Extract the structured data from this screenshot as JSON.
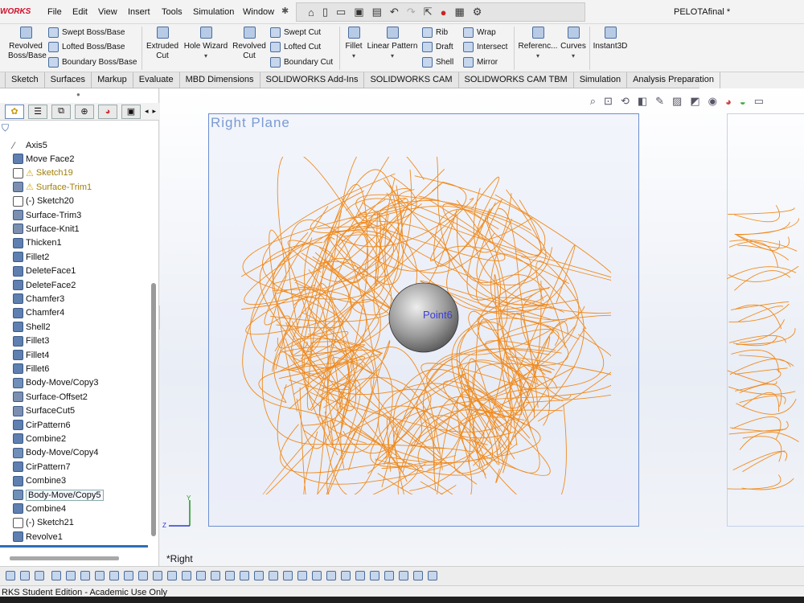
{
  "app": {
    "logo_text": "WORKS",
    "document_title": "PELOTAfinal *"
  },
  "menus": [
    "File",
    "Edit",
    "View",
    "Insert",
    "Tools",
    "Simulation",
    "Window"
  ],
  "ribbon": {
    "revolved_boss": "Revolved\nBoss/Base",
    "swept_boss": "Swept Boss/Base",
    "lofted_boss": "Lofted Boss/Base",
    "boundary_boss": "Boundary Boss/Base",
    "extruded_cut": "Extruded\nCut",
    "hole_wizard": "Hole Wizard",
    "revolved_cut": "Revolved\nCut",
    "swept_cut": "Swept Cut",
    "lofted_cut": "Lofted Cut",
    "boundary_cut": "Boundary Cut",
    "fillet": "Fillet",
    "linear_pattern": "Linear Pattern",
    "rib": "Rib",
    "draft": "Draft",
    "shell": "Shell",
    "wrap": "Wrap",
    "intersect": "Intersect",
    "mirror": "Mirror",
    "reference": "Referenc...",
    "curves": "Curves",
    "instant3d": "Instant3D"
  },
  "tabs": [
    "Sketch",
    "Surfaces",
    "Markup",
    "Evaluate",
    "MBD Dimensions",
    "SOLIDWORKS Add-Ins",
    "SOLIDWORKS CAM",
    "SOLIDWORKS CAM TBM",
    "Simulation",
    "Analysis Preparation"
  ],
  "tree": [
    {
      "label": "Axis5",
      "icon": "axis-icon",
      "state": "normal"
    },
    {
      "label": "Move Face2",
      "icon": "move-face-icon",
      "state": "normal"
    },
    {
      "label": "Sketch19",
      "icon": "sketch-icon",
      "state": "warning"
    },
    {
      "label": "Surface-Trim1",
      "icon": "surface-trim-icon",
      "state": "warning"
    },
    {
      "label": "(-) Sketch20",
      "icon": "sketch-icon",
      "state": "normal"
    },
    {
      "label": "Surface-Trim3",
      "icon": "surface-trim-icon",
      "state": "normal"
    },
    {
      "label": "Surface-Knit1",
      "icon": "surface-knit-icon",
      "state": "normal"
    },
    {
      "label": "Thicken1",
      "icon": "thicken-icon",
      "state": "normal"
    },
    {
      "label": "Fillet2",
      "icon": "fillet-icon",
      "state": "normal"
    },
    {
      "label": "DeleteFace1",
      "icon": "delete-face-icon",
      "state": "normal"
    },
    {
      "label": "DeleteFace2",
      "icon": "delete-face-icon",
      "state": "normal"
    },
    {
      "label": "Chamfer3",
      "icon": "chamfer-icon",
      "state": "normal"
    },
    {
      "label": "Chamfer4",
      "icon": "chamfer-icon",
      "state": "normal"
    },
    {
      "label": "Shell2",
      "icon": "shell-icon",
      "state": "normal"
    },
    {
      "label": "Fillet3",
      "icon": "fillet-icon",
      "state": "normal"
    },
    {
      "label": "Fillet4",
      "icon": "fillet-icon",
      "state": "normal"
    },
    {
      "label": "Fillet6",
      "icon": "fillet-icon",
      "state": "normal"
    },
    {
      "label": "Body-Move/Copy3",
      "icon": "body-move-icon",
      "state": "normal"
    },
    {
      "label": "Surface-Offset2",
      "icon": "surface-offset-icon",
      "state": "normal"
    },
    {
      "label": "SurfaceCut5",
      "icon": "surface-cut-icon",
      "state": "normal"
    },
    {
      "label": "CirPattern6",
      "icon": "circular-pattern-icon",
      "state": "normal"
    },
    {
      "label": "Combine2",
      "icon": "combine-icon",
      "state": "normal"
    },
    {
      "label": "Body-Move/Copy4",
      "icon": "body-move-icon",
      "state": "normal"
    },
    {
      "label": "CirPattern7",
      "icon": "circular-pattern-icon",
      "state": "normal"
    },
    {
      "label": "Combine3",
      "icon": "combine-icon",
      "state": "normal"
    },
    {
      "label": "Body-Move/Copy5",
      "icon": "body-move-icon",
      "state": "selected"
    },
    {
      "label": "Combine4",
      "icon": "combine-icon",
      "state": "normal"
    },
    {
      "label": "(-) Sketch21",
      "icon": "sketch-icon",
      "state": "normal"
    },
    {
      "label": "Revolve1",
      "icon": "revolve-icon",
      "state": "normal"
    }
  ],
  "graphics": {
    "plane_label": "Right Plane",
    "point_label": "Point6",
    "view_label": "*Right",
    "axis_y": "Y",
    "axis_z": "Z",
    "curve_color": "#f08a1c"
  },
  "status": {
    "edition": "RKS Student Edition - Academic Use Only"
  }
}
